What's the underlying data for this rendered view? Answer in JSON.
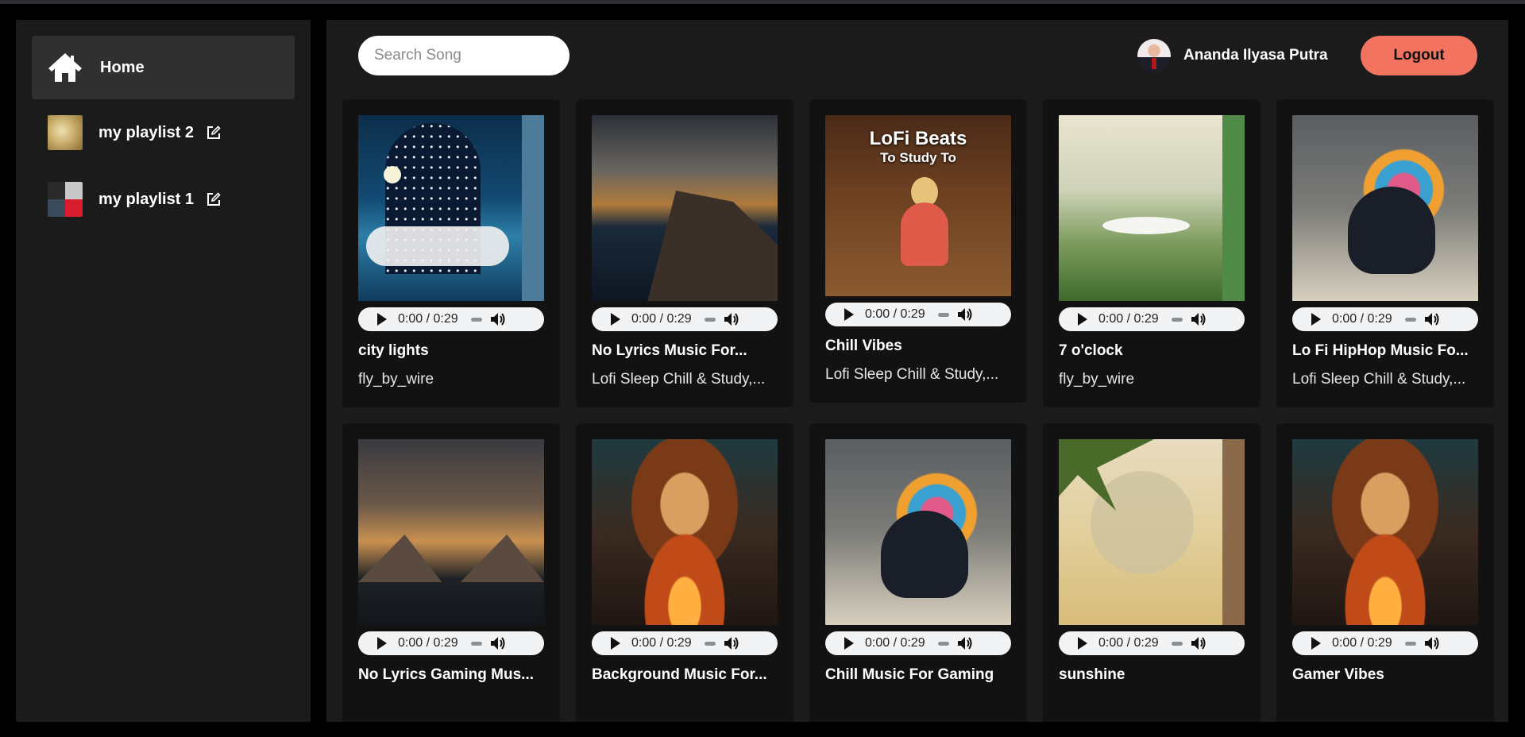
{
  "sidebar": {
    "home_label": "Home",
    "playlists": [
      {
        "label": "my playlist 2",
        "thumb": "gold-texture"
      },
      {
        "label": "my playlist 1",
        "thumb": "album-collage"
      }
    ]
  },
  "header": {
    "search_placeholder": "Search Song",
    "user_name": "Ananda Ilyasa Putra",
    "logout_label": "Logout"
  },
  "songs": [
    {
      "title": "city lights",
      "artist": "fly_by_wire",
      "time": "0:00 / 0:29",
      "cover": "city"
    },
    {
      "title": "No Lyrics Music For...",
      "artist": "Lofi Sleep Chill & Study,...",
      "time": "0:00 / 0:29",
      "cover": "island"
    },
    {
      "title": "Chill Vibes",
      "artist": "Lofi Sleep Chill & Study,...",
      "time": "0:00 / 0:29",
      "cover": "lofi",
      "cover_title": "LoFi Beats",
      "cover_subtitle": "To Study To"
    },
    {
      "title": "7 o'clock",
      "artist": "fly_by_wire",
      "time": "0:00 / 0:29",
      "cover": "oclock"
    },
    {
      "title": "Lo Fi HipHop Music Fo...",
      "artist": "Lofi Sleep Chill & Study,...",
      "time": "0:00 / 0:29",
      "cover": "hiphop"
    },
    {
      "title": "No Lyrics Gaming Mus...",
      "artist": "",
      "time": "0:00 / 0:29",
      "cover": "gaming"
    },
    {
      "title": "Background Music For...",
      "artist": "",
      "time": "0:00 / 0:29",
      "cover": "skull"
    },
    {
      "title": "Chill Music For Gaming",
      "artist": "",
      "time": "0:00 / 0:29",
      "cover": "hiphop"
    },
    {
      "title": "sunshine",
      "artist": "",
      "time": "0:00 / 0:29",
      "cover": "sunshine"
    },
    {
      "title": "Gamer Vibes",
      "artist": "",
      "time": "0:00 / 0:29",
      "cover": "skull"
    }
  ],
  "colors": {
    "background": "#000000",
    "panel": "#1b1b1b",
    "card": "#121212",
    "accent_logout": "#f37361",
    "nav_active": "#303030"
  },
  "icons": {
    "home": "home-icon",
    "edit": "edit-icon",
    "play": "play-icon",
    "volume": "volume-icon"
  }
}
